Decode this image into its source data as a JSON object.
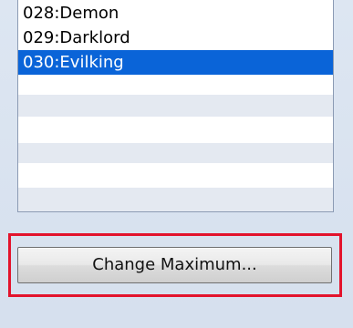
{
  "list": {
    "items": [
      {
        "label": "028:Demon"
      },
      {
        "label": "029:Darklord"
      },
      {
        "label": "030:Evilking"
      }
    ],
    "selected_index": 2
  },
  "button": {
    "label": "Change Maximum..."
  },
  "colors": {
    "selection": "#0a64d8",
    "highlight_frame": "#e3132c",
    "alt_row": "#e4e9f1"
  }
}
